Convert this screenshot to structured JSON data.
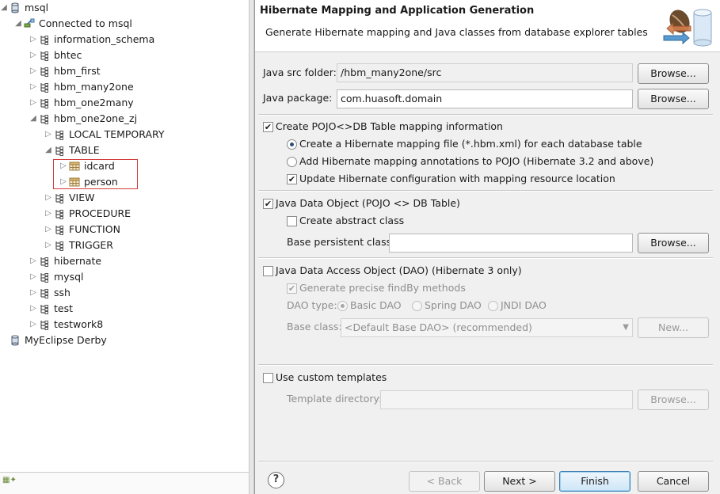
{
  "tree": {
    "rows": [
      {
        "label": "msql",
        "icon": "database-icon",
        "expander": "expanded"
      },
      {
        "label": "Connected to msql",
        "icon": "connection-icon",
        "expander": "expanded"
      },
      {
        "label": "information_schema",
        "icon": "schema-icon",
        "expander": "collapsed"
      },
      {
        "label": "bhtec",
        "icon": "schema-icon",
        "expander": "collapsed"
      },
      {
        "label": "hbm_first",
        "icon": "schema-icon",
        "expander": "collapsed"
      },
      {
        "label": "hbm_many2one",
        "icon": "schema-icon",
        "expander": "collapsed"
      },
      {
        "label": "hbm_one2many",
        "icon": "schema-icon",
        "expander": "collapsed"
      },
      {
        "label": "hbm_one2one_zj",
        "icon": "schema-icon",
        "expander": "expanded"
      },
      {
        "label": "LOCAL TEMPORARY",
        "icon": "folder-icon",
        "expander": "collapsed"
      },
      {
        "label": "TABLE",
        "icon": "folder-icon",
        "expander": "expanded"
      },
      {
        "label": "idcard",
        "icon": "table-icon",
        "expander": "collapsed"
      },
      {
        "label": "person",
        "icon": "table-icon",
        "expander": "collapsed"
      },
      {
        "label": "VIEW",
        "icon": "folder-icon",
        "expander": "collapsed"
      },
      {
        "label": "PROCEDURE",
        "icon": "folder-icon",
        "expander": "collapsed"
      },
      {
        "label": "FUNCTION",
        "icon": "folder-icon",
        "expander": "collapsed"
      },
      {
        "label": "TRIGGER",
        "icon": "folder-icon",
        "expander": "collapsed"
      },
      {
        "label": "hibernate",
        "icon": "schema-icon",
        "expander": "collapsed"
      },
      {
        "label": "mysql",
        "icon": "schema-icon",
        "expander": "collapsed"
      },
      {
        "label": "ssh",
        "icon": "schema-icon",
        "expander": "collapsed"
      },
      {
        "label": "test",
        "icon": "schema-icon",
        "expander": "collapsed"
      },
      {
        "label": "testwork8",
        "icon": "schema-icon",
        "expander": "collapsed"
      },
      {
        "label": "MyEclipse Derby",
        "icon": "database-icon",
        "expander": "none"
      }
    ]
  },
  "dialog": {
    "title": "Hibernate Mapping and Application Generation",
    "subtitle": "Generate Hibernate mapping and Java classes from database explorer tables",
    "src_folder_label": "Java src folder:",
    "src_folder_value": "/hbm_many2one/src",
    "package_label": "Java package:",
    "package_value": "com.huasoft.domain",
    "browse_label": "Browse...",
    "create_pojo": {
      "label": "Create POJO<>DB Table mapping information",
      "checked": true
    },
    "mapping_file": {
      "label": "Create a Hibernate mapping file (*.hbm.xml) for each database table",
      "selected": true
    },
    "annotations": {
      "label": "Add Hibernate mapping annotations to POJO (Hibernate 3.2 and above)",
      "selected": false
    },
    "update_config": {
      "label": "Update Hibernate configuration with mapping resource location",
      "checked": true
    },
    "java_data_object": {
      "label": "Java Data Object (POJO <> DB Table)",
      "checked": true
    },
    "abstract_class": {
      "label": "Create abstract class",
      "checked": false
    },
    "base_persistent_label": "Base persistent class:",
    "base_persistent_value": "",
    "dao": {
      "label": "Java Data Access Object (DAO) (Hibernate 3 only)",
      "checked": false
    },
    "findby": {
      "label": "Generate precise findBy methods",
      "checked": true
    },
    "dao_type_label": "DAO type:",
    "dao_types": [
      {
        "label": "Basic DAO",
        "selected": true
      },
      {
        "label": "Spring DAO",
        "selected": false
      },
      {
        "label": "JNDI DAO",
        "selected": false
      }
    ],
    "base_class_label": "Base class:",
    "base_class_value": "<Default Base DAO> (recommended)",
    "new_label": "New...",
    "custom_templates": {
      "label": "Use custom templates",
      "checked": false
    },
    "template_dir_label": "Template directory:",
    "template_dir_value": "",
    "footer": {
      "back": "< Back",
      "next": "Next >",
      "finish": "Finish",
      "cancel": "Cancel",
      "help_glyph": "?"
    }
  }
}
